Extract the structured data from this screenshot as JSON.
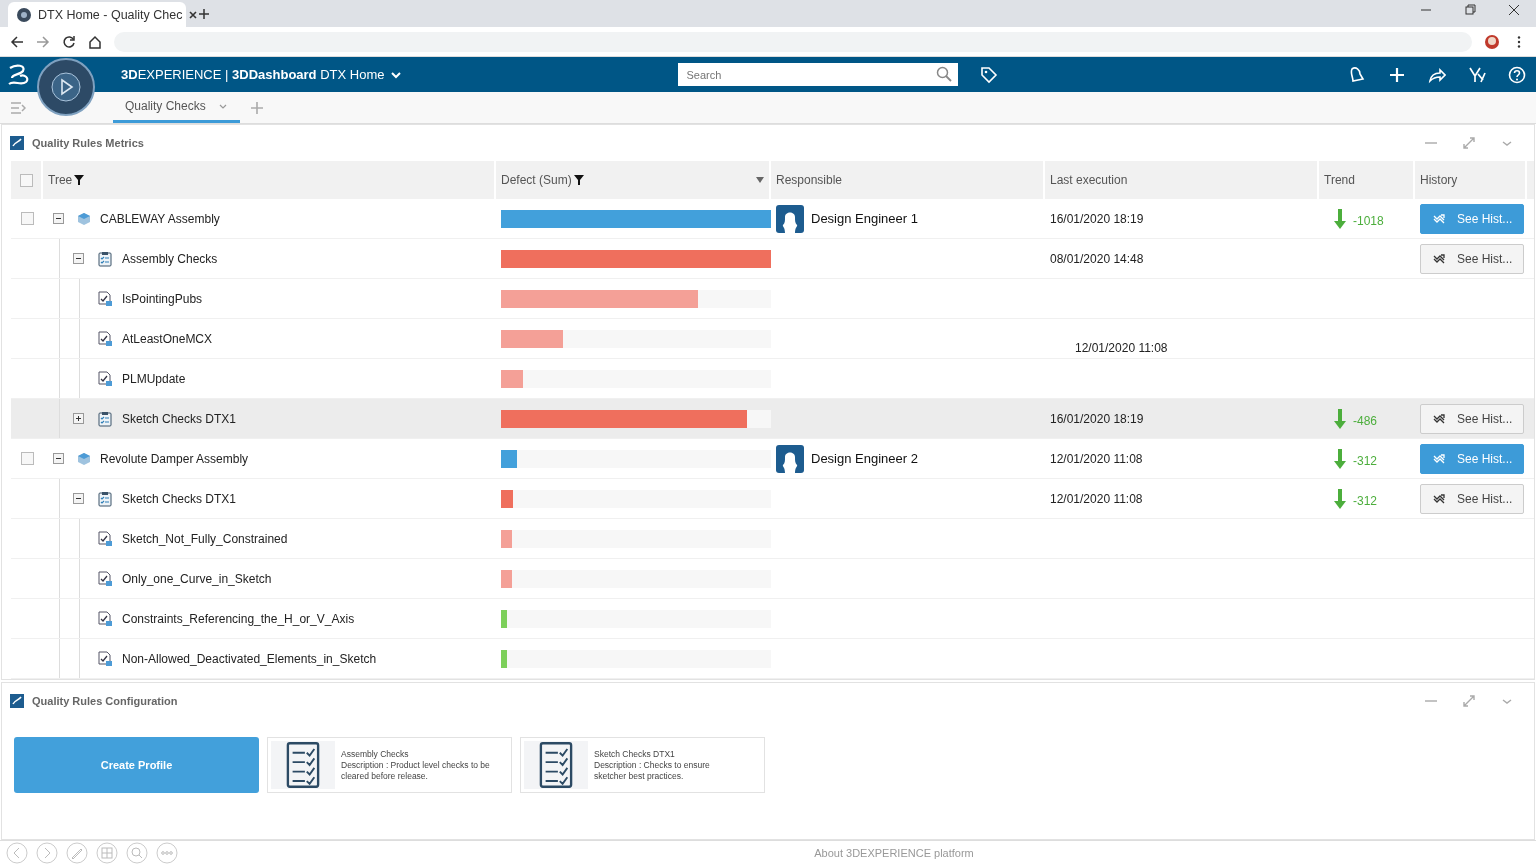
{
  "browser": {
    "tab_title": "DTX Home - Quality Chec"
  },
  "header": {
    "title": "**3D**EXPERIENCE | **3DDashboard** DTX Home",
    "search": {
      "placeholder": "Search"
    }
  },
  "tabs": [
    {
      "label": "Quality Checks",
      "selected": true
    }
  ],
  "metrics": {
    "title": "Quality Rules Metrics",
    "select_all": {
      "checked": false
    },
    "columns": [
      "Tree",
      "Defect (Sum)",
      "Responsible",
      "Last execution",
      "Trend",
      "History"
    ],
    "rows": [
      {
        "kind": "assembly",
        "name": "CABLEWAY Assembly",
        "checked": false,
        "expanded": true,
        "highlighted": false,
        "level": 1.0,
        "color": "#42a0db",
        "responsible": "Design Engineer 1",
        "last_execution": "16/01/2020 18:19",
        "trend": "-1018",
        "history": {
          "label": "See Hist...",
          "primary": true
        },
        "children": [
          {
            "kind": "checklist",
            "name": "Assembly Checks",
            "expanded": true,
            "highlighted": false,
            "level": 1.0,
            "color": "#ef6f5d",
            "last_execution": "08/01/2020 14:48",
            "history": {
              "label": "See Hist...",
              "primary": false
            },
            "children": [
              {
                "kind": "rule",
                "name": "IsPointingPubs",
                "highlighted": false,
                "level": 0.73,
                "color": "#f4a097"
              },
              {
                "kind": "rule",
                "name": "AtLeastOneMCX",
                "highlighted": false,
                "level": 0.23,
                "color": "#f4a097",
                "last_execution": "12/01/2020 11:08"
              },
              {
                "kind": "rule",
                "name": "PLMUpdate",
                "highlighted": false,
                "level": 0.08,
                "color": "#f4a097"
              }
            ]
          },
          {
            "kind": "checklist",
            "name": "Sketch Checks DTX1",
            "expanded": false,
            "highlighted": true,
            "level": 0.91,
            "color": "#ef6f5d",
            "last_execution": "16/01/2020 18:19",
            "trend": "-486",
            "history": {
              "label": "See Hist...",
              "primary": false
            }
          }
        ]
      },
      {
        "kind": "assembly",
        "name": "Revolute Damper Assembly",
        "checked": false,
        "expanded": true,
        "highlighted": false,
        "level": 0.06,
        "color": "#42a0db",
        "responsible": "Design Engineer 2",
        "last_execution": "12/01/2020 11:08",
        "trend": "-312",
        "history": {
          "label": "See Hist...",
          "primary": true
        },
        "children": [
          {
            "kind": "checklist",
            "name": "Sketch Checks DTX1",
            "expanded": true,
            "highlighted": false,
            "level": 0.045,
            "color": "#ef6f5d",
            "last_execution": "12/01/2020 11:08",
            "trend": "-312",
            "history": {
              "label": "See Hist...",
              "primary": false
            },
            "children": [
              {
                "kind": "rule",
                "name": "Sketch_Not_Fully_Constrained",
                "highlighted": false,
                "level": 0.04,
                "color": "#f4a097"
              },
              {
                "kind": "rule",
                "name": "Only_one_Curve_in_Sketch",
                "highlighted": false,
                "level": 0.04,
                "color": "#f4a097"
              },
              {
                "kind": "rule",
                "name": "Constraints_Referencing_the_H_or_V_Axis",
                "highlighted": false,
                "level": 0.018,
                "color": "#7ccf5a"
              },
              {
                "kind": "rule",
                "name": "Non-Allowed_Deactivated_Elements_in_Sketch",
                "highlighted": false,
                "level": 0.018,
                "color": "#7ccf5a"
              }
            ]
          }
        ]
      }
    ]
  },
  "configuration": {
    "title": "Quality Rules Configuration",
    "create_button": "Create Profile",
    "profiles": [
      {
        "name": "Assembly Checks",
        "description": "Description : Product level checks to be cleared before release."
      },
      {
        "name": "Sketch Checks DTX1",
        "description": "Description : Checks to ensure sketcher best practices."
      }
    ]
  },
  "footer": {
    "about": "About 3DEXPERIENCE platform"
  }
}
